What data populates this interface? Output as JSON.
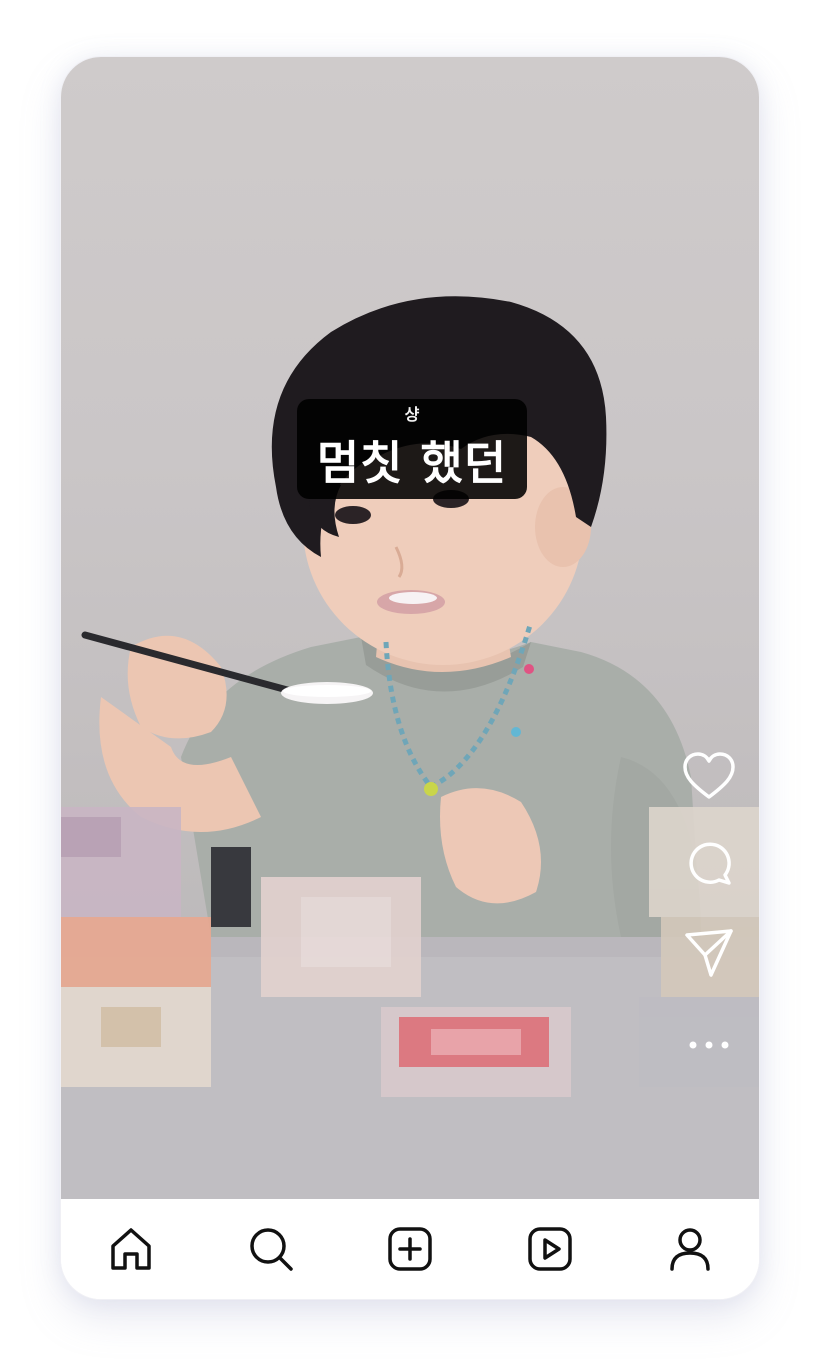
{
  "video": {
    "caption_logo": "샹",
    "caption_text": "멈칫 했던"
  },
  "actions": [
    {
      "name": "like",
      "icon": "heart-icon"
    },
    {
      "name": "comment",
      "icon": "comment-icon"
    },
    {
      "name": "share",
      "icon": "send-icon"
    },
    {
      "name": "more",
      "icon": "more-icon"
    }
  ],
  "bottom_nav": [
    {
      "name": "home",
      "icon": "home-icon"
    },
    {
      "name": "search",
      "icon": "search-icon"
    },
    {
      "name": "create",
      "icon": "plus-square-icon"
    },
    {
      "name": "reels",
      "icon": "reels-icon"
    },
    {
      "name": "profile",
      "icon": "profile-icon"
    }
  ],
  "colors": {
    "icon_dark": "#111111",
    "icon_light": "#ffffff",
    "caption_bg": "#000000"
  }
}
